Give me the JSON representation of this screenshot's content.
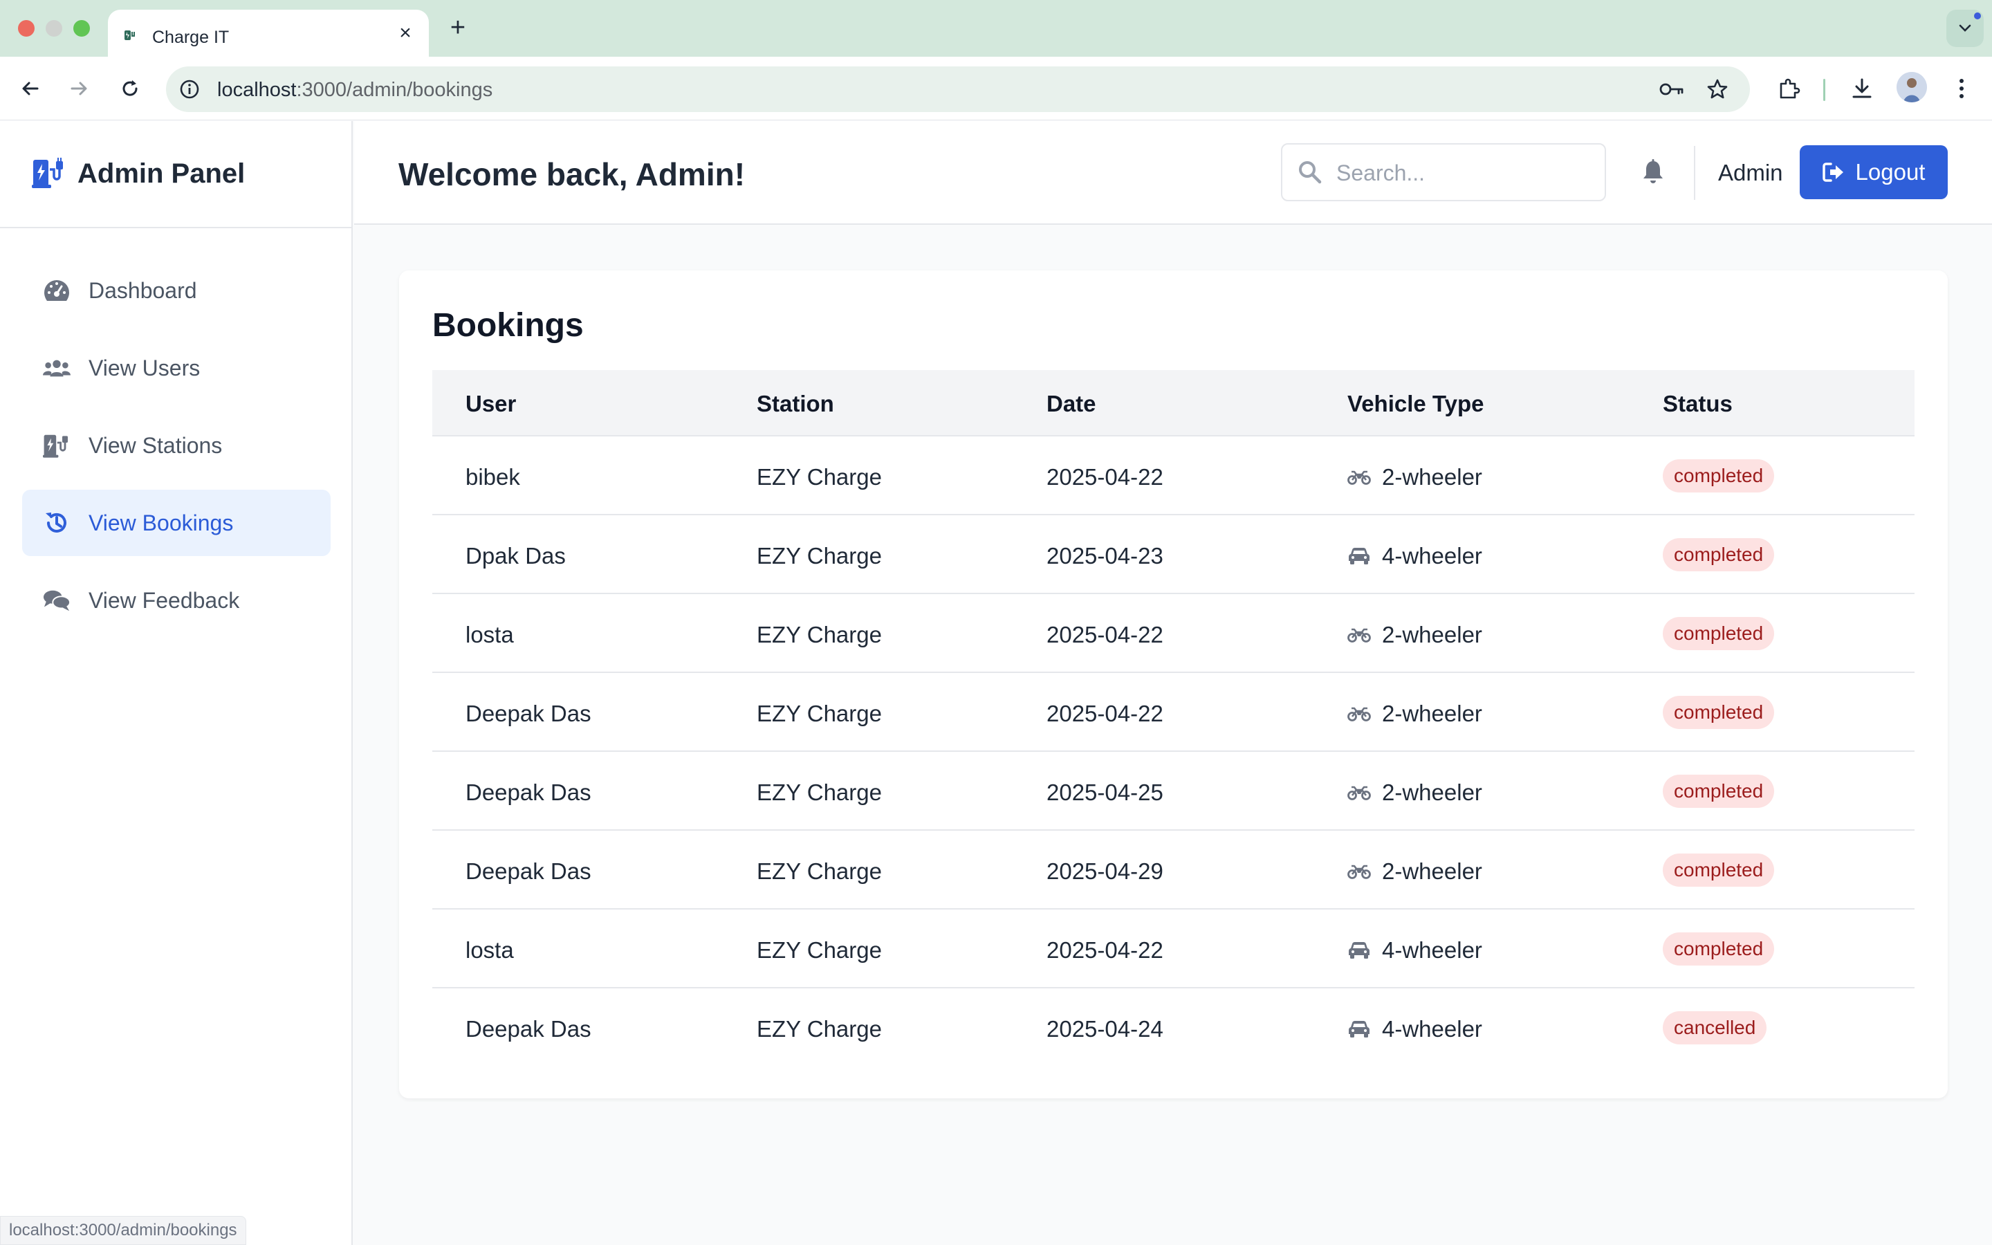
{
  "browser": {
    "tab_title": "Charge IT",
    "new_tab": "+",
    "close": "×",
    "url_host": "localhost",
    "url_path": ":3000/admin/bookings",
    "status_url": "localhost:3000/admin/bookings"
  },
  "sidebar": {
    "brand": "Admin Panel",
    "items": [
      {
        "label": "Dashboard",
        "icon": "dashboard-gauge-icon",
        "active": false
      },
      {
        "label": "View Users",
        "icon": "users-icon",
        "active": false
      },
      {
        "label": "View Stations",
        "icon": "charging-station-icon",
        "active": false
      },
      {
        "label": "View Bookings",
        "icon": "history-icon",
        "active": true
      },
      {
        "label": "View Feedback",
        "icon": "comments-icon",
        "active": false
      }
    ]
  },
  "header": {
    "welcome": "Welcome back, Admin!",
    "search_placeholder": "Search...",
    "admin_name": "Admin",
    "logout_label": "Logout"
  },
  "bookings": {
    "title": "Bookings",
    "columns": [
      "User",
      "Station",
      "Date",
      "Vehicle Type",
      "Status"
    ],
    "rows": [
      {
        "user": "bibek",
        "station": "EZY Charge",
        "date": "2025-04-22",
        "vehicle": "2-wheeler",
        "status": "completed"
      },
      {
        "user": "Dpak Das",
        "station": "EZY Charge",
        "date": "2025-04-23",
        "vehicle": "4-wheeler",
        "status": "completed"
      },
      {
        "user": "losta",
        "station": "EZY Charge",
        "date": "2025-04-22",
        "vehicle": "2-wheeler",
        "status": "completed"
      },
      {
        "user": "Deepak Das",
        "station": "EZY Charge",
        "date": "2025-04-22",
        "vehicle": "2-wheeler",
        "status": "completed"
      },
      {
        "user": "Deepak Das",
        "station": "EZY Charge",
        "date": "2025-04-25",
        "vehicle": "2-wheeler",
        "status": "completed"
      },
      {
        "user": "Deepak Das",
        "station": "EZY Charge",
        "date": "2025-04-29",
        "vehicle": "2-wheeler",
        "status": "completed"
      },
      {
        "user": "losta",
        "station": "EZY Charge",
        "date": "2025-04-22",
        "vehicle": "4-wheeler",
        "status": "completed"
      },
      {
        "user": "Deepak Das",
        "station": "EZY Charge",
        "date": "2025-04-24",
        "vehicle": "4-wheeler",
        "status": "cancelled"
      }
    ]
  },
  "colors": {
    "accent": "#2f5fd9",
    "active_bg": "#eaf2fe",
    "badge_bg": "#fde2e2",
    "badge_text": "#9b1c1c"
  }
}
